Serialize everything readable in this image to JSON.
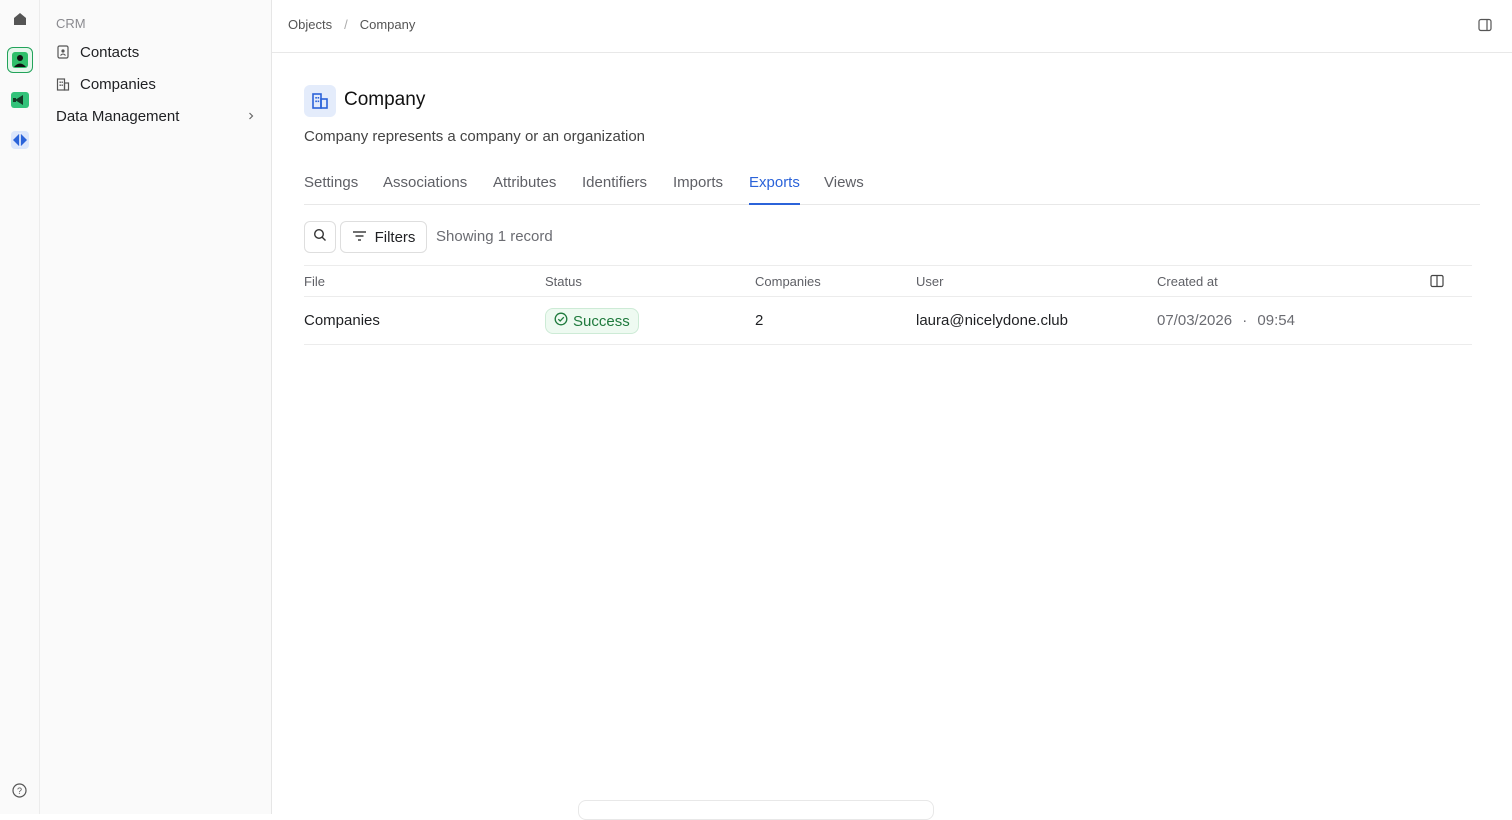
{
  "sidebar": {
    "section_label": "CRM",
    "items": [
      {
        "label": "Contacts",
        "icon": "contact-book-icon"
      },
      {
        "label": "Companies",
        "icon": "building-icon"
      }
    ],
    "group_label": "Data Management"
  },
  "breadcrumb": {
    "root": "Objects",
    "current": "Company"
  },
  "page": {
    "title": "Company",
    "description": "Company represents a company or an organization"
  },
  "tabs": [
    "Settings",
    "Associations",
    "Attributes",
    "Identifiers",
    "Imports",
    "Exports",
    "Views"
  ],
  "active_tab": "Exports",
  "toolbar": {
    "filters_label": "Filters",
    "record_count": "Showing 1 record"
  },
  "table": {
    "columns": [
      "File",
      "Status",
      "Companies",
      "User",
      "Created at"
    ],
    "rows": [
      {
        "file": "Companies",
        "status": "Success",
        "companies": "2",
        "user": "laura@nicelydone.club",
        "created_date": "07/03/2026",
        "created_time": "09:54"
      }
    ]
  },
  "colors": {
    "accent": "#2b63d9",
    "success": "#1f7a3d",
    "rail_active": "#22a35a"
  }
}
